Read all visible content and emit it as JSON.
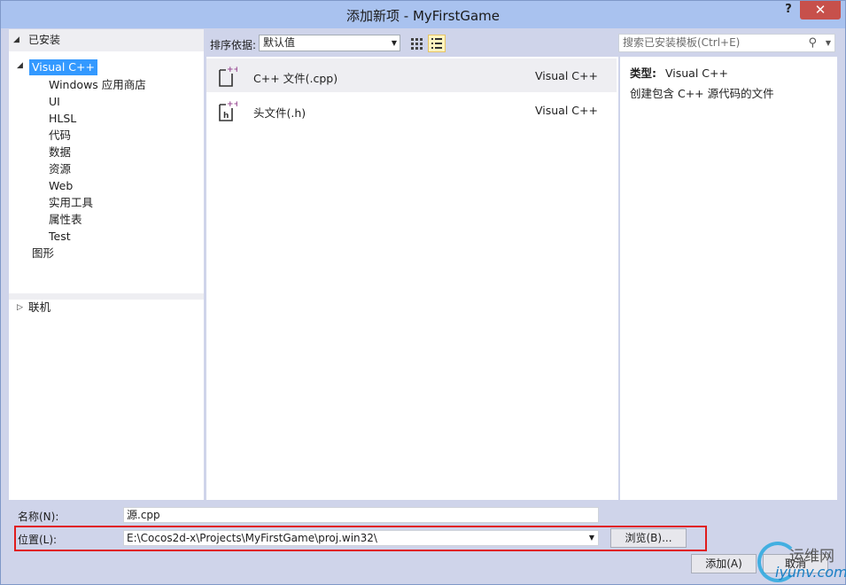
{
  "window": {
    "title": "添加新项 - MyFirstGame",
    "help_label": "?",
    "close_label": "✕"
  },
  "left": {
    "installed_label": "已安装",
    "tree": [
      {
        "label": "Visual C++",
        "level": 0,
        "selected": true
      },
      {
        "label": "Windows 应用商店",
        "level": 1
      },
      {
        "label": "UI",
        "level": 1
      },
      {
        "label": "HLSL",
        "level": 1
      },
      {
        "label": "代码",
        "level": 1
      },
      {
        "label": "数据",
        "level": 1
      },
      {
        "label": "资源",
        "level": 1
      },
      {
        "label": "Web",
        "level": 1
      },
      {
        "label": "实用工具",
        "level": 1
      },
      {
        "label": "属性表",
        "level": 1
      },
      {
        "label": "Test",
        "level": 1
      },
      {
        "label": "图形",
        "level": 0
      }
    ],
    "online_label": "联机"
  },
  "toolbar": {
    "sort_label": "排序依据:",
    "sort_value": "默认值",
    "search_placeholder": "搜索已安装模板(Ctrl+E)"
  },
  "items": [
    {
      "name": "C++ 文件(.cpp)",
      "lang": "Visual C++",
      "selected": true
    },
    {
      "name": "头文件(.h)",
      "lang": "Visual C++",
      "selected": false
    }
  ],
  "details": {
    "type_label": "类型:",
    "type_value": "Visual C++",
    "description": "创建包含 C++ 源代码的文件"
  },
  "bottom": {
    "name_label": "名称(N):",
    "name_value": "源.cpp",
    "location_label": "位置(L):",
    "location_value": "E:\\Cocos2d-x\\Projects\\MyFirstGame\\proj.win32\\",
    "browse_label": "浏览(B)...",
    "add_label": "添加(A)",
    "cancel_label": "取消"
  },
  "watermark": {
    "top": "运维网",
    "bottom": "iyunv.com"
  },
  "colors": {
    "titlebar": "#a9c2ef",
    "selection": "#3399ff",
    "close": "#c7504b",
    "highlight_box": "#e01c1c"
  }
}
